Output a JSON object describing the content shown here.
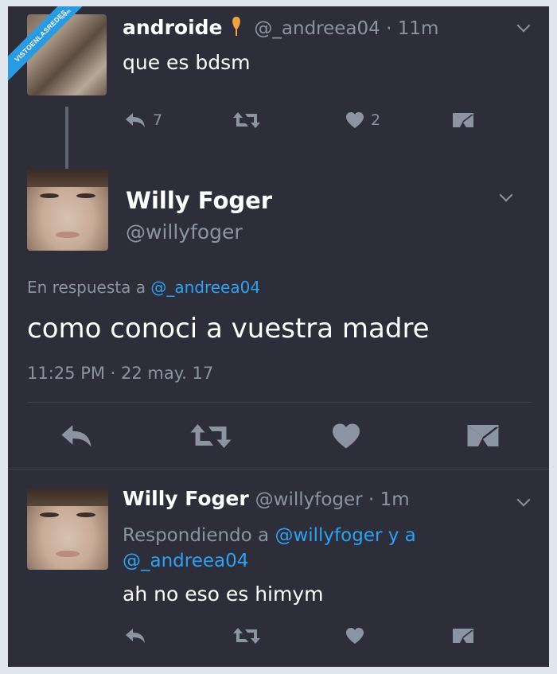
{
  "watermark": {
    "text": "VISTOENLASREDES",
    "suffix": ".com"
  },
  "tweet1": {
    "display_name": "androide",
    "handle_time": "@_andreea04 · 11m",
    "text": "que es bdsm",
    "reply_count": "7",
    "like_count": "2"
  },
  "tweet2": {
    "display_name": "Willy Foger",
    "handle": "@willyfoger",
    "reply_prefix": "En respuesta a",
    "reply_to": "@_andreea04",
    "text": "como conoci a vuestra madre",
    "timestamp": "11:25 PM · 22 may. 17"
  },
  "tweet3": {
    "display_name": "Willy Foger",
    "handle_time": "@willyfoger · 1m",
    "reply_prefix": "Respondiendo a",
    "reply_to_1": "@willyfoger y a",
    "reply_to_2": "@_andreea04",
    "text": "ah no eso es himym"
  },
  "colors": {
    "background": "#2d2e3a",
    "muted": "#8c93a3",
    "link": "#2ea1f2",
    "text": "#ffffff"
  },
  "icons": [
    "reply-icon",
    "retweet-icon",
    "like-icon",
    "dm-icon",
    "chevron-down-icon",
    "pin-icon"
  ]
}
